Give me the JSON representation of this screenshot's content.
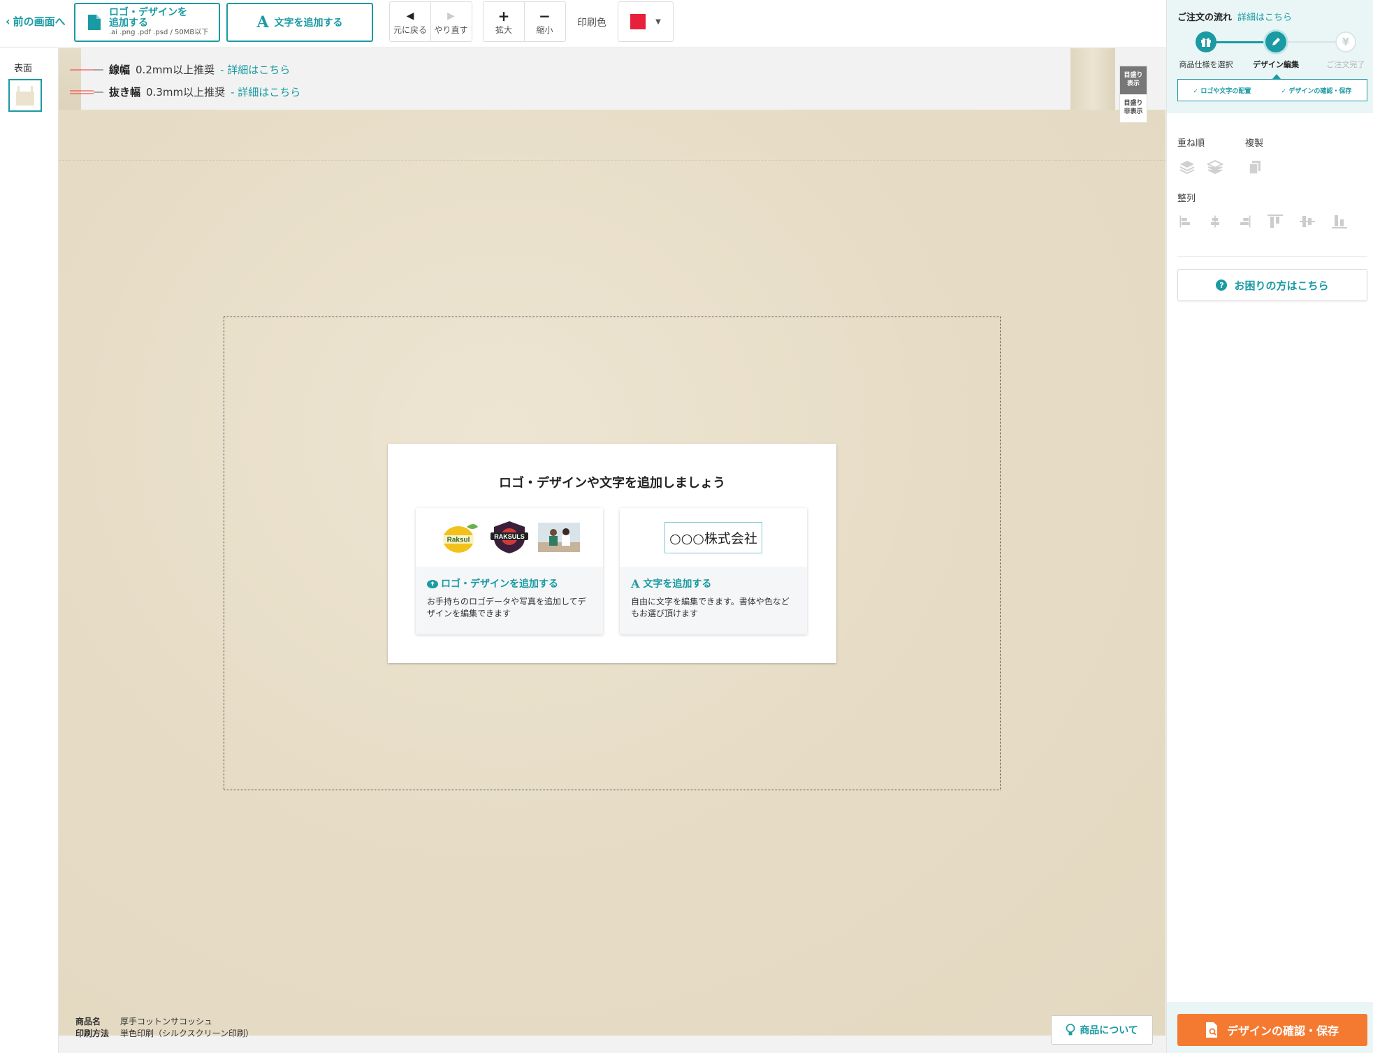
{
  "toolbar": {
    "back_label": "前の画面へ",
    "add_logo_label_line1": "ロゴ・デザインを",
    "add_logo_label_line2": "追加する",
    "add_logo_formats": ".ai .png .pdf .psd / 50MB以下",
    "add_text_label": "文字を追加する",
    "undo_label": "元に戻る",
    "redo_label": "やり直す",
    "zoom_in_label": "拡大",
    "zoom_out_label": "縮小",
    "print_color_label": "印刷色",
    "print_color_value": "#e8203a"
  },
  "sides": {
    "front_label": "表面"
  },
  "guides": {
    "line_width_title": "線幅",
    "line_width_value": "0.2mm以上推奨",
    "line_width_link": "- 詳細はこちら",
    "cutout_width_title": "抜き幅",
    "cutout_width_value": "0.3mm以上推奨",
    "cutout_width_link": "- 詳細はこちら"
  },
  "ruler_toggle": {
    "show_label_line1": "目盛り",
    "show_label_line2": "表示",
    "hide_label_line1": "目盛り",
    "hide_label_line2": "非表示"
  },
  "dialog": {
    "title": "ロゴ・デザインや文字を追加しましょう",
    "logo_card_title": "ロゴ・デザインを追加する",
    "logo_card_desc": "お手持ちのロゴデータや写真を追加してデザインを編集できます",
    "text_card_sample": "○○○株式会社",
    "text_card_title": "文字を追加する",
    "text_card_desc": "自由に文字を編集できます。書体や色などもお選び頂けます",
    "logo_sample_1": "Raksul",
    "logo_sample_2": "RAKSULS"
  },
  "product": {
    "name_label": "商品名",
    "name_value": "厚手コットンサコッシュ",
    "method_label": "印刷方法",
    "method_value": "単色印刷（シルクスクリーン印刷）",
    "about_button": "商品について"
  },
  "order_flow": {
    "title": "ご注文の流れ",
    "detail_link": "詳細はこちら",
    "steps": [
      {
        "label": "商品仕様を選択",
        "state": "done"
      },
      {
        "label": "デザイン編集",
        "state": "current"
      },
      {
        "label": "ご注文完了",
        "state": "todo"
      }
    ],
    "checks": [
      "ロゴや文字の配置",
      "デザインの確認・保存"
    ]
  },
  "tools": {
    "order_label": "重ね順",
    "duplicate_label": "複製",
    "align_label": "整列"
  },
  "help_button": "お困りの方はこちら",
  "confirm_button": "デザインの確認・保存",
  "colors": {
    "accent": "#1a9aa3",
    "cta": "#f47a32",
    "canvas_bg": "#f2f2f2",
    "fabric": "#e9e0cb"
  }
}
